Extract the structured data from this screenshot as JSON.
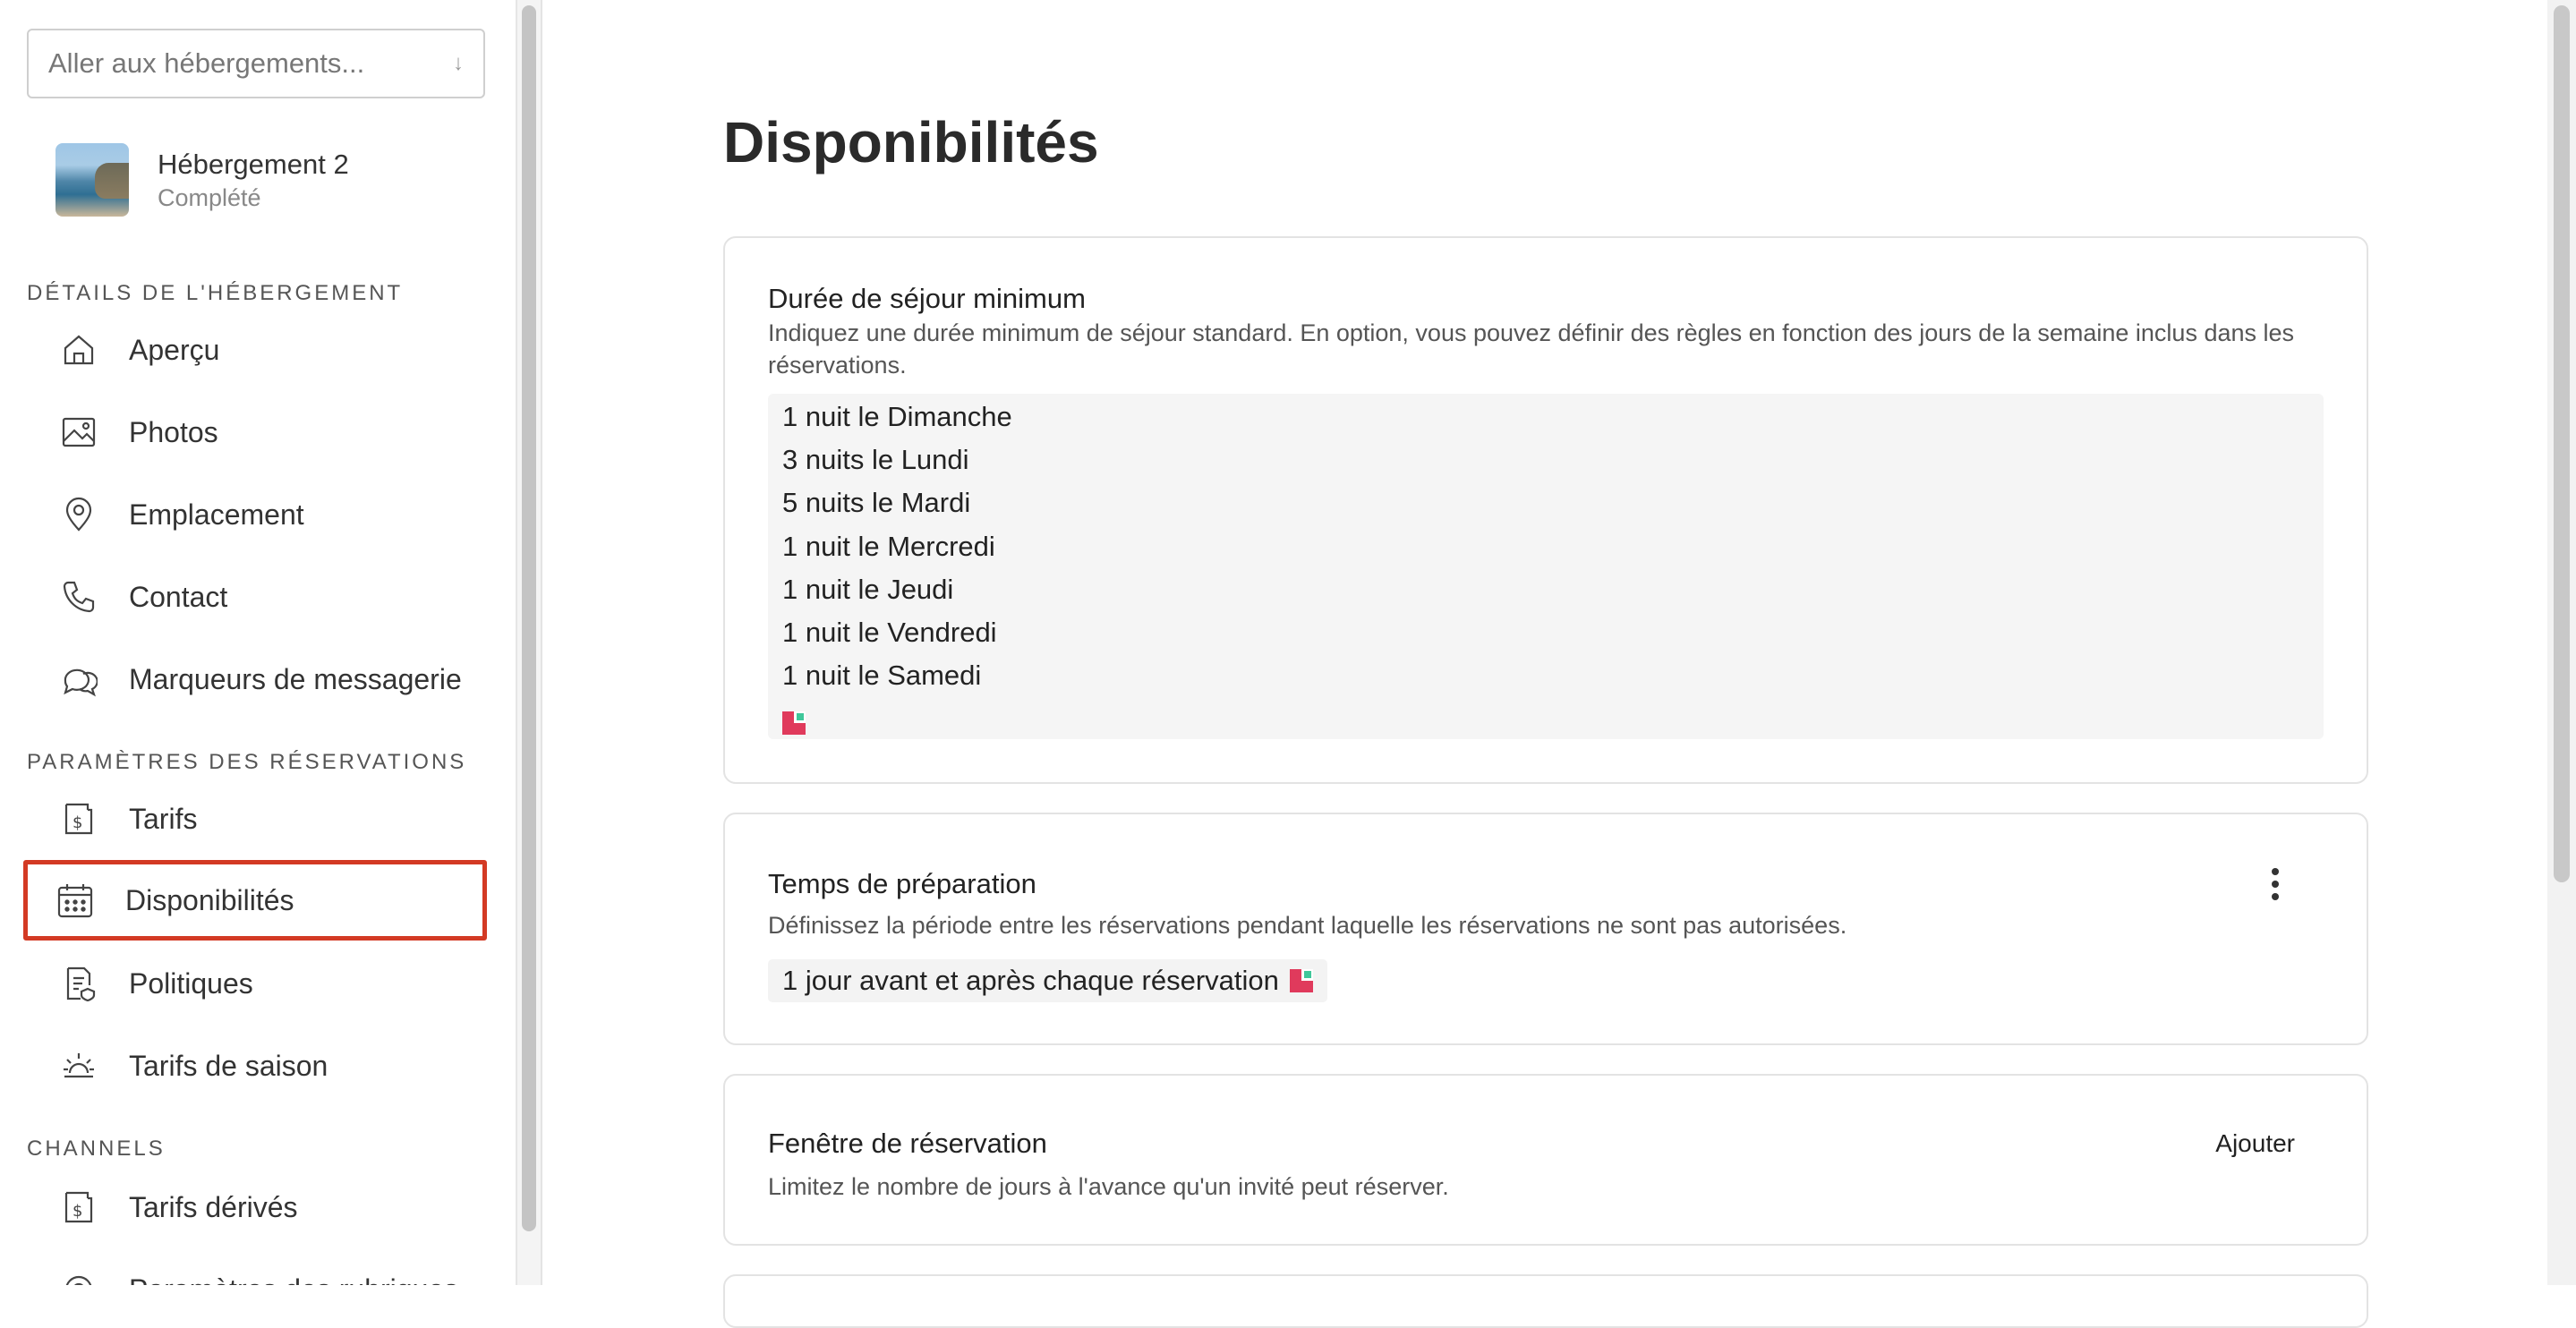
{
  "sidebar": {
    "goto_placeholder": "Aller aux hébergements...",
    "goto_arrow": "↓",
    "listing": {
      "name": "Hébergement 2",
      "status": "Complété"
    },
    "sections": [
      {
        "heading": "DÉTAILS DE L'HÉBERGEMENT",
        "items": [
          {
            "label": "Aperçu",
            "icon": "home-icon"
          },
          {
            "label": "Photos",
            "icon": "image-icon"
          },
          {
            "label": "Emplacement",
            "icon": "location-pin-icon"
          },
          {
            "label": "Contact",
            "icon": "phone-icon"
          },
          {
            "label": "Marqueurs de messagerie",
            "icon": "chat-bubbles-icon"
          }
        ]
      },
      {
        "heading": "PARAMÈTRES DES RÉSERVATIONS",
        "items": [
          {
            "label": "Tarifs",
            "icon": "price-tag-icon"
          },
          {
            "label": "Disponibilités",
            "icon": "calendar-icon",
            "active": true
          },
          {
            "label": "Politiques",
            "icon": "policy-document-icon"
          },
          {
            "label": "Tarifs de saison",
            "icon": "sun-icon"
          }
        ]
      },
      {
        "heading": "CHANNELS",
        "items": [
          {
            "label": "Tarifs dérivés",
            "icon": "price-tag-icon"
          },
          {
            "label": "Paramètres des rubriques",
            "icon": "settings-icon"
          }
        ]
      }
    ]
  },
  "main": {
    "title": "Disponibilités",
    "min_stay": {
      "title": "Durée de séjour minimum",
      "description": "Indiquez une durée minimum de séjour standard. En option, vous pouvez définir des règles en fonction des jours de la semaine inclus dans les réservations.",
      "rules": [
        "1 nuit le Dimanche",
        "3 nuits le Lundi",
        "5 nuits le Mardi",
        "1 nuit le Mercredi",
        "1 nuit le Jeudi",
        "1 nuit le Vendredi",
        "1 nuit le Samedi"
      ]
    },
    "prep_time": {
      "title": "Temps de préparation",
      "description": "Définissez la période entre les réservations pendant laquelle les réservations ne sont pas autorisées.",
      "value": "1 jour avant et après chaque réservation"
    },
    "booking_window": {
      "title": "Fenêtre de réservation",
      "description": "Limitez le nombre de jours à l'avance qu'un invité peut réserver.",
      "action": "Ajouter"
    }
  },
  "colors": {
    "active_outline": "#d33a24",
    "badge_red": "#e03a5c",
    "badge_green": "#3fc79a"
  }
}
